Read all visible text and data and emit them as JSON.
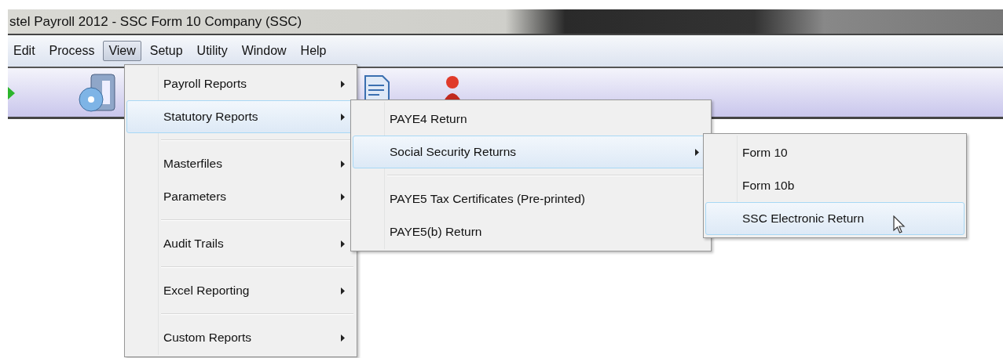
{
  "window": {
    "title": "stel Payroll 2012 - SSC Form 10 Company (SSC)"
  },
  "menubar": [
    {
      "label": "Edit",
      "selected": false
    },
    {
      "label": "Process",
      "selected": false
    },
    {
      "label": "View",
      "selected": true
    },
    {
      "label": "Setup",
      "selected": false
    },
    {
      "label": "Utility",
      "selected": false
    },
    {
      "label": "Window",
      "selected": false
    },
    {
      "label": "Help",
      "selected": false
    }
  ],
  "menus": [
    {
      "items": [
        {
          "kind": "item",
          "label": "Payroll Reports",
          "submenu": true,
          "selected": false
        },
        {
          "kind": "item",
          "label": "Statutory Reports",
          "submenu": true,
          "selected": true
        },
        {
          "kind": "separator"
        },
        {
          "kind": "item",
          "label": "Masterfiles",
          "submenu": true,
          "selected": false
        },
        {
          "kind": "item",
          "label": "Parameters",
          "submenu": true,
          "selected": false
        },
        {
          "kind": "separator"
        },
        {
          "kind": "item",
          "label": "Audit Trails",
          "submenu": true,
          "selected": false
        },
        {
          "kind": "separator"
        },
        {
          "kind": "item",
          "label": "Excel Reporting",
          "submenu": true,
          "selected": false
        },
        {
          "kind": "separator"
        },
        {
          "kind": "item",
          "label": "Custom Reports",
          "submenu": true,
          "selected": false
        }
      ]
    },
    {
      "items": [
        {
          "kind": "item",
          "label": "PAYE4 Return",
          "submenu": false,
          "selected": false
        },
        {
          "kind": "item",
          "label": "Social Security Returns",
          "submenu": true,
          "selected": true
        },
        {
          "kind": "separator"
        },
        {
          "kind": "item",
          "label": "PAYE5 Tax Certificates (Pre-printed)",
          "submenu": false,
          "selected": false
        },
        {
          "kind": "item",
          "label": "PAYE5(b) Return",
          "submenu": false,
          "selected": false
        }
      ]
    },
    {
      "items": [
        {
          "kind": "item",
          "label": "Form 10",
          "submenu": false,
          "selected": false
        },
        {
          "kind": "item",
          "label": "Form 10b",
          "submenu": false,
          "selected": false
        },
        {
          "kind": "item",
          "label": "SSC Electronic Return",
          "submenu": false,
          "selected": true
        }
      ]
    }
  ]
}
